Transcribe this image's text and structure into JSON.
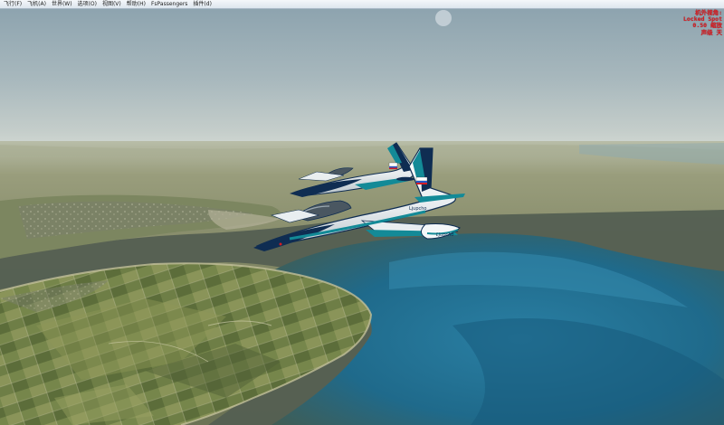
{
  "menubar": {
    "items": [
      {
        "label": "飞行(F)"
      },
      {
        "label": "飞机(A)"
      },
      {
        "label": "世界(W)"
      },
      {
        "label": "选项(O)"
      },
      {
        "label": "视图(V)"
      },
      {
        "label": "帮助(H)"
      },
      {
        "label": "FsPassengers"
      },
      {
        "label": "插件(d)"
      }
    ]
  },
  "hud": {
    "line1": "机外视角:",
    "line2": "Locked Spot",
    "line3": "0.50 缩放",
    "line4": "声级 天"
  },
  "aircraft": {
    "livery_main": "#f4f7f8",
    "livery_accent": "#0f2d52",
    "livery_trim": "#138a97",
    "canopy": "#4a5761",
    "tail_flag_colors": [
      "#ffffff",
      "#2458c8",
      "#d21c24"
    ],
    "tail_text": "Ljupcho",
    "wingtip_text": "Ljupcho",
    "nose_text": "Rulo"
  },
  "colors": {
    "sky_top": "#8ea5b0",
    "sky_horizon": "#c6d0cf",
    "haze_land": "#838865",
    "sea_deep": "#1c6d8f",
    "field_green": "#6b7d45"
  }
}
